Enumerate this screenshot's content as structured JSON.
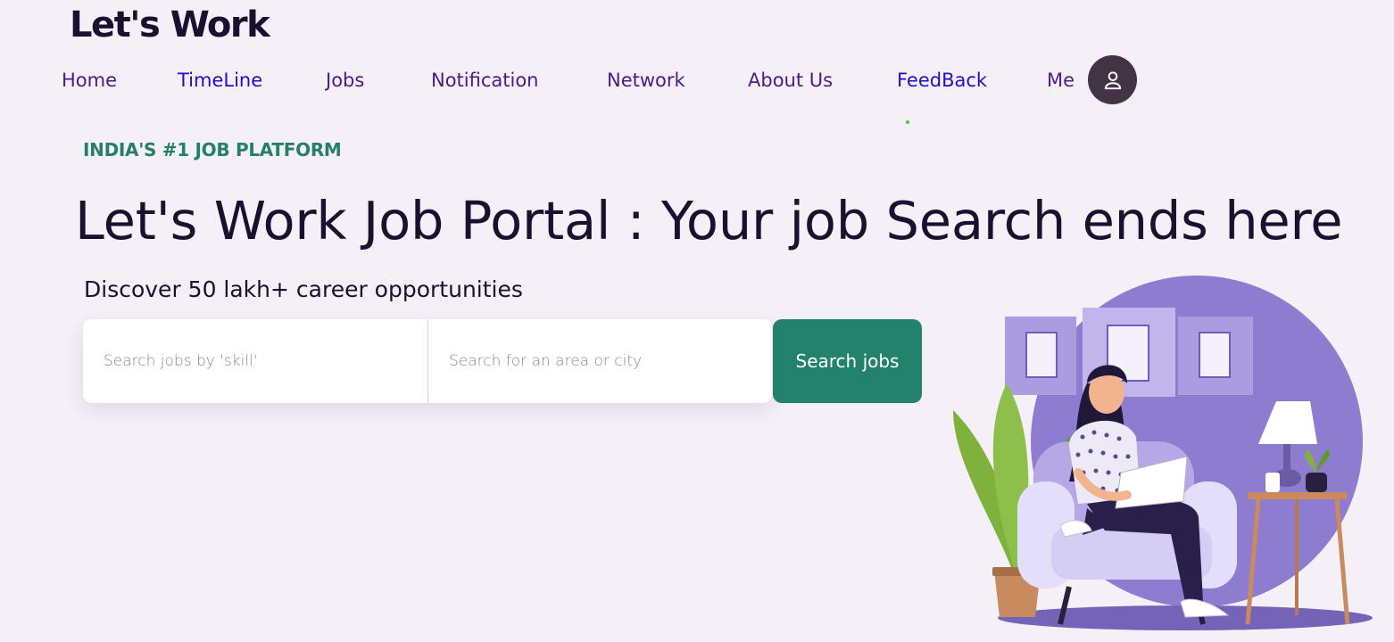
{
  "brand": "Let's Work",
  "nav": {
    "items": [
      {
        "label": "Home"
      },
      {
        "label": "TimeLine"
      },
      {
        "label": "Jobs"
      },
      {
        "label": "Notification"
      },
      {
        "label": "Network"
      },
      {
        "label": "About Us"
      },
      {
        "label": "FeedBack"
      },
      {
        "label": "Me"
      }
    ],
    "profile_icon": "user-icon"
  },
  "hero": {
    "eyebrow": "INDIA'S #1 JOB PLATFORM",
    "title": "Let's Work Job Portal : Your job Search ends here",
    "subtitle": "Discover 50 lakh+ career opportunities"
  },
  "search": {
    "skill_placeholder": "Search jobs by 'skill'",
    "location_placeholder": "Search for an area or city",
    "button_label": "Search jobs"
  },
  "colors": {
    "background": "#f5eff8",
    "accent": "#22826b",
    "nav_text": "#4a1d86",
    "nav_active": "#1b12c9",
    "illustration_circle": "#8e7cd0"
  }
}
